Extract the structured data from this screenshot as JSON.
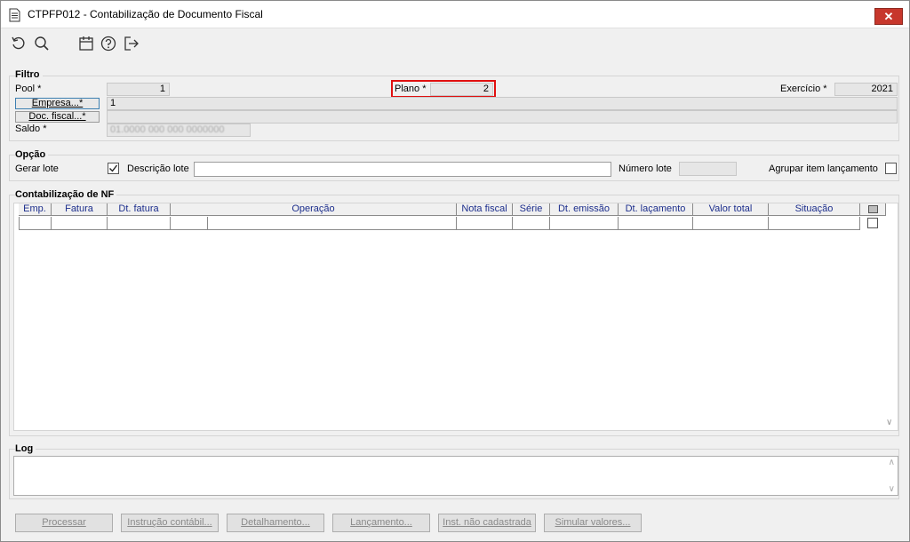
{
  "window": {
    "title": "CTPFP012 - Contabilização de Documento Fiscal",
    "close_label": "✕"
  },
  "toolbar": {
    "icons": [
      "refresh-icon",
      "search-icon",
      "calendar-icon",
      "help-icon",
      "exit-icon"
    ]
  },
  "filtro": {
    "title": "Filtro",
    "pool_label": "Pool *",
    "pool_value": "1",
    "plano_label": "Plano *",
    "plano_value": "2",
    "exercicio_label": "Exercício *",
    "exercicio_value": "2021",
    "empresa_button": "Empresa...*",
    "empresa_value": "1",
    "doc_fiscal_button": "Doc. fiscal...*",
    "doc_fiscal_value": "",
    "saldo_label": "Saldo *",
    "saldo_value": "01.0000 000 000 0000000"
  },
  "opcao": {
    "title": "Opção",
    "gerar_lote_label": "Gerar lote",
    "gerar_lote_checked": true,
    "descricao_lote_label": "Descrição lote",
    "descricao_lote_value": "",
    "numero_lote_label": "Número lote",
    "numero_lote_value": "",
    "agrupar_label": "Agrupar item lançamento",
    "agrupar_checked": false
  },
  "contabilizacao": {
    "title": "Contabilização de NF",
    "columns": [
      "Emp.",
      "Fatura",
      "Dt. fatura",
      "Operação",
      "Nota fiscal",
      "Série",
      "Dt. emissão",
      "Dt. laçamento",
      "Valor total",
      "Situação"
    ]
  },
  "log": {
    "title": "Log",
    "content": ""
  },
  "buttons": {
    "processar": "Processar",
    "instrucao": "Instrução contábil...",
    "detalhamento": "Detalhamento...",
    "lancamento": "Lançamento...",
    "inst_nao_cadastrada": "Inst. não cadastrada",
    "simular": "Simular valores..."
  }
}
